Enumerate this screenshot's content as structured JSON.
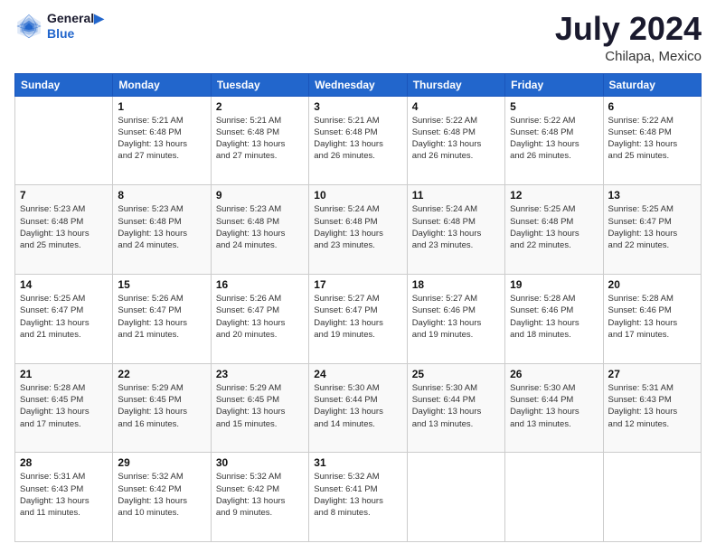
{
  "logo": {
    "line1": "General",
    "line2": "Blue"
  },
  "title": "July 2024",
  "subtitle": "Chilapa, Mexico",
  "headers": [
    "Sunday",
    "Monday",
    "Tuesday",
    "Wednesday",
    "Thursday",
    "Friday",
    "Saturday"
  ],
  "weeks": [
    [
      {
        "day": "",
        "info": ""
      },
      {
        "day": "1",
        "info": "Sunrise: 5:21 AM\nSunset: 6:48 PM\nDaylight: 13 hours\nand 27 minutes."
      },
      {
        "day": "2",
        "info": "Sunrise: 5:21 AM\nSunset: 6:48 PM\nDaylight: 13 hours\nand 27 minutes."
      },
      {
        "day": "3",
        "info": "Sunrise: 5:21 AM\nSunset: 6:48 PM\nDaylight: 13 hours\nand 26 minutes."
      },
      {
        "day": "4",
        "info": "Sunrise: 5:22 AM\nSunset: 6:48 PM\nDaylight: 13 hours\nand 26 minutes."
      },
      {
        "day": "5",
        "info": "Sunrise: 5:22 AM\nSunset: 6:48 PM\nDaylight: 13 hours\nand 26 minutes."
      },
      {
        "day": "6",
        "info": "Sunrise: 5:22 AM\nSunset: 6:48 PM\nDaylight: 13 hours\nand 25 minutes."
      }
    ],
    [
      {
        "day": "7",
        "info": "Sunrise: 5:23 AM\nSunset: 6:48 PM\nDaylight: 13 hours\nand 25 minutes."
      },
      {
        "day": "8",
        "info": "Sunrise: 5:23 AM\nSunset: 6:48 PM\nDaylight: 13 hours\nand 24 minutes."
      },
      {
        "day": "9",
        "info": "Sunrise: 5:23 AM\nSunset: 6:48 PM\nDaylight: 13 hours\nand 24 minutes."
      },
      {
        "day": "10",
        "info": "Sunrise: 5:24 AM\nSunset: 6:48 PM\nDaylight: 13 hours\nand 23 minutes."
      },
      {
        "day": "11",
        "info": "Sunrise: 5:24 AM\nSunset: 6:48 PM\nDaylight: 13 hours\nand 23 minutes."
      },
      {
        "day": "12",
        "info": "Sunrise: 5:25 AM\nSunset: 6:48 PM\nDaylight: 13 hours\nand 22 minutes."
      },
      {
        "day": "13",
        "info": "Sunrise: 5:25 AM\nSunset: 6:47 PM\nDaylight: 13 hours\nand 22 minutes."
      }
    ],
    [
      {
        "day": "14",
        "info": "Sunrise: 5:25 AM\nSunset: 6:47 PM\nDaylight: 13 hours\nand 21 minutes."
      },
      {
        "day": "15",
        "info": "Sunrise: 5:26 AM\nSunset: 6:47 PM\nDaylight: 13 hours\nand 21 minutes."
      },
      {
        "day": "16",
        "info": "Sunrise: 5:26 AM\nSunset: 6:47 PM\nDaylight: 13 hours\nand 20 minutes."
      },
      {
        "day": "17",
        "info": "Sunrise: 5:27 AM\nSunset: 6:47 PM\nDaylight: 13 hours\nand 19 minutes."
      },
      {
        "day": "18",
        "info": "Sunrise: 5:27 AM\nSunset: 6:46 PM\nDaylight: 13 hours\nand 19 minutes."
      },
      {
        "day": "19",
        "info": "Sunrise: 5:28 AM\nSunset: 6:46 PM\nDaylight: 13 hours\nand 18 minutes."
      },
      {
        "day": "20",
        "info": "Sunrise: 5:28 AM\nSunset: 6:46 PM\nDaylight: 13 hours\nand 17 minutes."
      }
    ],
    [
      {
        "day": "21",
        "info": "Sunrise: 5:28 AM\nSunset: 6:45 PM\nDaylight: 13 hours\nand 17 minutes."
      },
      {
        "day": "22",
        "info": "Sunrise: 5:29 AM\nSunset: 6:45 PM\nDaylight: 13 hours\nand 16 minutes."
      },
      {
        "day": "23",
        "info": "Sunrise: 5:29 AM\nSunset: 6:45 PM\nDaylight: 13 hours\nand 15 minutes."
      },
      {
        "day": "24",
        "info": "Sunrise: 5:30 AM\nSunset: 6:44 PM\nDaylight: 13 hours\nand 14 minutes."
      },
      {
        "day": "25",
        "info": "Sunrise: 5:30 AM\nSunset: 6:44 PM\nDaylight: 13 hours\nand 13 minutes."
      },
      {
        "day": "26",
        "info": "Sunrise: 5:30 AM\nSunset: 6:44 PM\nDaylight: 13 hours\nand 13 minutes."
      },
      {
        "day": "27",
        "info": "Sunrise: 5:31 AM\nSunset: 6:43 PM\nDaylight: 13 hours\nand 12 minutes."
      }
    ],
    [
      {
        "day": "28",
        "info": "Sunrise: 5:31 AM\nSunset: 6:43 PM\nDaylight: 13 hours\nand 11 minutes."
      },
      {
        "day": "29",
        "info": "Sunrise: 5:32 AM\nSunset: 6:42 PM\nDaylight: 13 hours\nand 10 minutes."
      },
      {
        "day": "30",
        "info": "Sunrise: 5:32 AM\nSunset: 6:42 PM\nDaylight: 13 hours\nand 9 minutes."
      },
      {
        "day": "31",
        "info": "Sunrise: 5:32 AM\nSunset: 6:41 PM\nDaylight: 13 hours\nand 8 minutes."
      },
      {
        "day": "",
        "info": ""
      },
      {
        "day": "",
        "info": ""
      },
      {
        "day": "",
        "info": ""
      }
    ]
  ]
}
